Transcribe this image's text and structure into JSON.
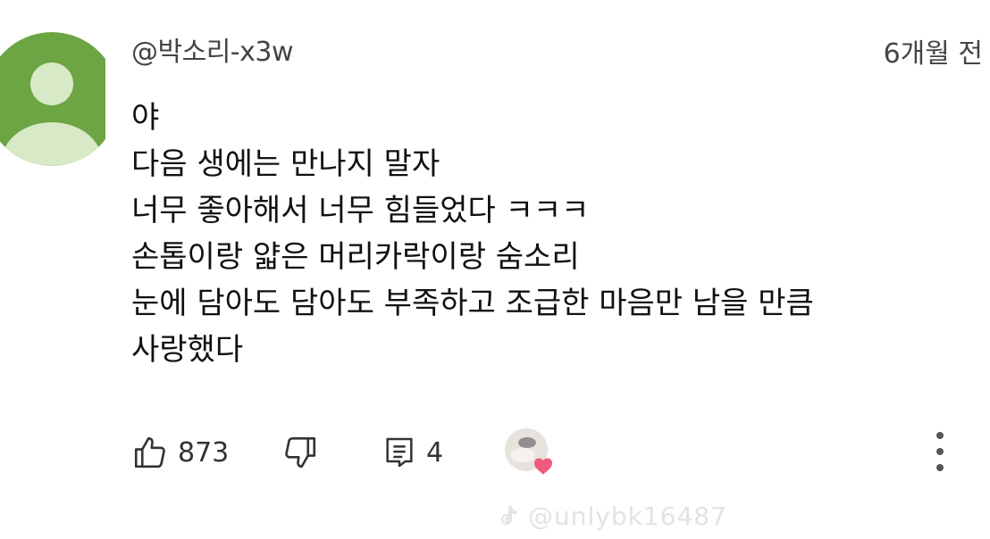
{
  "comment": {
    "author": "@박소리-x3w",
    "timestamp": "6개월 전",
    "lines": [
      "야",
      "다음 생에는 만나지 말자",
      "너무 좋아해서 너무 힘들었다 ㅋㅋㅋ",
      "손톱이랑 얇은 머리카락이랑 숨소리",
      "눈에 담아도 담아도 부족하고 조급한 마음만 남을 만큼",
      "사랑했다"
    ],
    "likes": "873",
    "replies": "4"
  },
  "icons": {
    "like": "thumbs-up-icon",
    "dislike": "thumbs-down-icon",
    "reply": "comment-icon",
    "creator_heart": "heart-icon",
    "more": "more-vertical-icon",
    "watermark": "tiktok-icon"
  },
  "watermark": {
    "text": "@unlybk16487"
  },
  "colors": {
    "avatar_background": "#6da545",
    "avatar_figure": "#d8e9c7",
    "heart": "#f05a7e",
    "text": "#111111",
    "meta": "#444444"
  }
}
